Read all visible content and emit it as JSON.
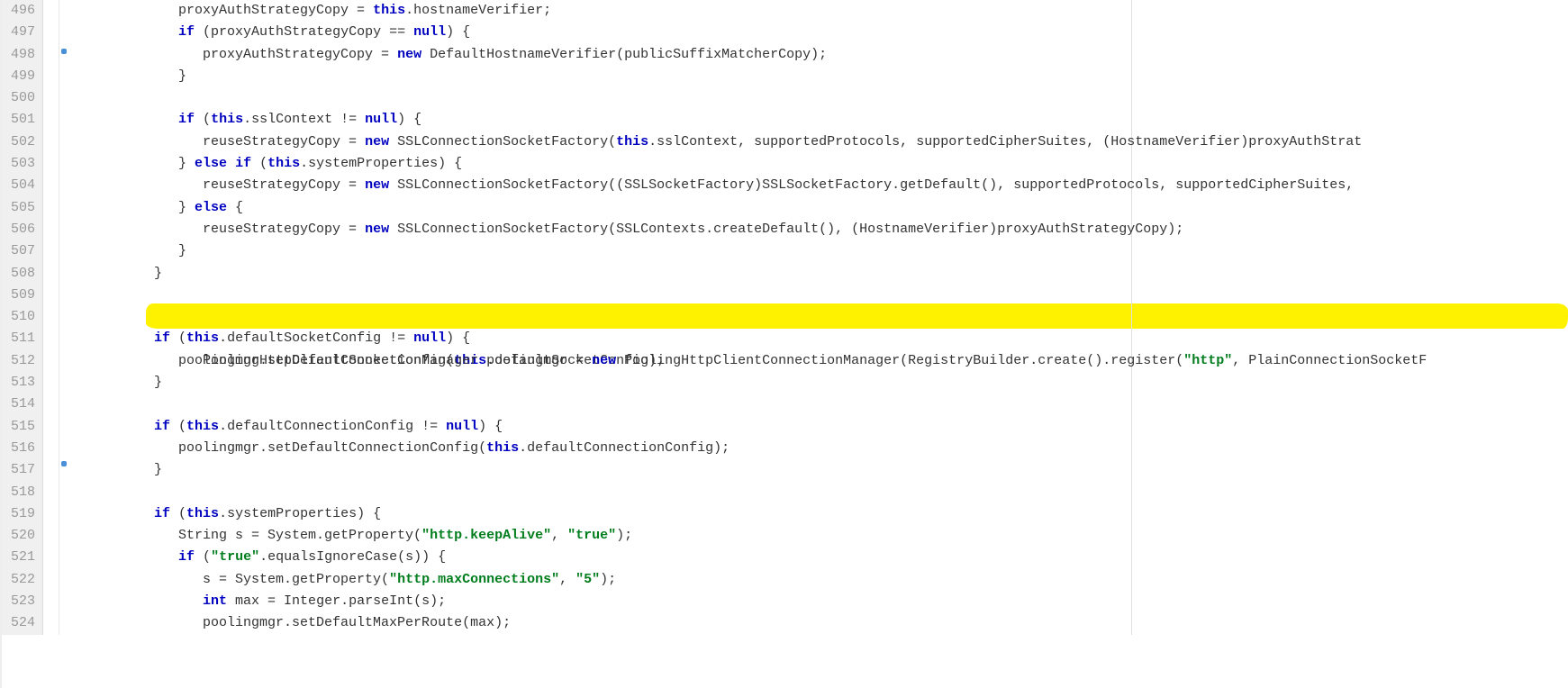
{
  "gutter": {
    "start": 496,
    "end": 524
  },
  "code": {
    "l496": "            proxyAuthStrategyCopy = ",
    "l496_kw": "this",
    "l496b": ".hostnameVerifier;",
    "l497a": "            ",
    "l497_if": "if",
    "l497b": " (proxyAuthStrategyCopy == ",
    "l497_null": "null",
    "l497c": ") {",
    "l498a": "               proxyAuthStrategyCopy = ",
    "l498_new": "new",
    "l498b": " DefaultHostnameVerifier(publicSuffixMatcherCopy);",
    "l499": "            }",
    "l500": "",
    "l501a": "            ",
    "l501_if": "if",
    "l501b": " (",
    "l501_this": "this",
    "l501c": ".sslContext != ",
    "l501_null": "null",
    "l501d": ") {",
    "l502a": "               reuseStrategyCopy = ",
    "l502_new": "new",
    "l502b": " SSLConnectionSocketFactory(",
    "l502_this": "this",
    "l502c": ".sslContext, supportedProtocols, supportedCipherSuites, (HostnameVerifier)proxyAuthStrat",
    "l503a": "            } ",
    "l503_else": "else",
    "l503b": " ",
    "l503_if": "if",
    "l503c": " (",
    "l503_this": "this",
    "l503d": ".systemProperties) {",
    "l504a": "               reuseStrategyCopy = ",
    "l504_new": "new",
    "l504b": " SSLConnectionSocketFactory((SSLSocketFactory)SSLSocketFactory.getDefault(), supportedProtocols, supportedCipherSuites, ",
    "l505a": "            } ",
    "l505_else": "else",
    "l505b": " {",
    "l506a": "               reuseStrategyCopy = ",
    "l506_new": "new",
    "l506b": " SSLConnectionSocketFactory(SSLContexts.createDefault(), (HostnameVerifier)proxyAuthStrategyCopy);",
    "l507": "            }",
    "l508": "         }",
    "l509": "",
    "l510a": "         PoolingHttpClientConnectionManager poolingmgr = ",
    "l510_new": "new",
    "l510b": " PoolingHttpClientConnectionManager(RegistryBuilder.create().register(",
    "l510_str": "\"http\"",
    "l510c": ", PlainConnectionSocketF",
    "l511a": "         ",
    "l511_if": "if",
    "l511b": " (",
    "l511_this": "this",
    "l511c": ".defaultSocketConfig != ",
    "l511_null": "null",
    "l511d": ") {",
    "l512a": "            poolingmgr.setDefaultSocketConfig(",
    "l512_this": "this",
    "l512b": ".defaultSocketConfig);",
    "l513": "         }",
    "l514": "",
    "l515a": "         ",
    "l515_if": "if",
    "l515b": " (",
    "l515_this": "this",
    "l515c": ".defaultConnectionConfig != ",
    "l515_null": "null",
    "l515d": ") {",
    "l516a": "            poolingmgr.setDefaultConnectionConfig(",
    "l516_this": "this",
    "l516b": ".defaultConnectionConfig);",
    "l517": "         }",
    "l518": "",
    "l519a": "         ",
    "l519_if": "if",
    "l519b": " (",
    "l519_this": "this",
    "l519c": ".systemProperties) {",
    "l520a": "            String s = System.getProperty(",
    "l520_s1": "\"http.keepAlive\"",
    "l520b": ", ",
    "l520_s2": "\"true\"",
    "l520c": ");",
    "l521a": "            ",
    "l521_if": "if",
    "l521b": " (",
    "l521_s": "\"true\"",
    "l521c": ".equalsIgnoreCase(s)) {",
    "l522a": "               s = System.getProperty(",
    "l522_s1": "\"http.maxConnections\"",
    "l522b": ", ",
    "l522_s2": "\"5\"",
    "l522c": ");",
    "l523a": "               ",
    "l523_int": "int",
    "l523b": " max = Integer.parseInt(s);",
    "l524": "               poolingmgr.setDefaultMaxPerRoute(max);"
  }
}
